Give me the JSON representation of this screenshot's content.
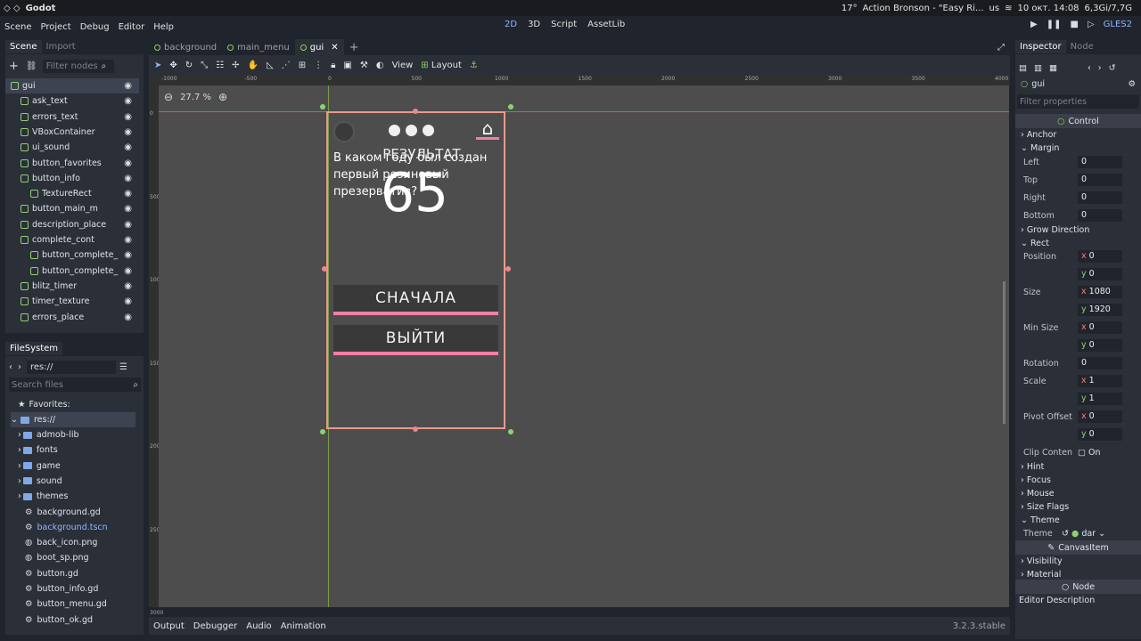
{
  "sysbar": {
    "app": "Godot",
    "temp": "17°",
    "media": "Action Bronson - \"Easy Ri...",
    "lang": "us",
    "datetime": "10 окт. 14:08",
    "mem": "6,3Gi/7,7G"
  },
  "menubar": {
    "items": [
      "Scene",
      "Project",
      "Debug",
      "Editor",
      "Help"
    ],
    "workspaces": [
      "2D",
      "3D",
      "Script",
      "AssetLib"
    ],
    "renderer": "GLES2"
  },
  "scene_panel": {
    "tabs": [
      "Scene",
      "Import"
    ],
    "filter_placeholder": "Filter nodes",
    "nodes": [
      "gui",
      "ask_text",
      "errors_text",
      "VBoxContainer",
      "ui_sound",
      "button_favorites",
      "button_info",
      "TextureRect",
      "button_main_m",
      "description_place",
      "complete_cont",
      "button_complete_",
      "button_complete_",
      "blitz_timer",
      "timer_texture",
      "errors_place"
    ]
  },
  "filesystem": {
    "title": "FileSystem",
    "path": "res://",
    "search_placeholder": "Search files",
    "favorites": "Favorites:",
    "root": "res://",
    "items": [
      "admob-lib",
      "fonts",
      "game",
      "sound",
      "themes",
      "background.gd",
      "background.tscn",
      "back_icon.png",
      "boot_sp.png",
      "button.gd",
      "button_info.gd",
      "button_menu.gd",
      "button_ok.gd"
    ]
  },
  "editor": {
    "tabs": [
      "background",
      "main_menu",
      "gui"
    ],
    "zoom": "27.7 %",
    "view": "View",
    "layout": "Layout",
    "ruler_h": [
      "-1000",
      "-500",
      "0",
      "500",
      "1000",
      "1500",
      "2000",
      "2500",
      "3000",
      "3500",
      "4000"
    ],
    "ruler_v": [
      "0",
      "500",
      "1000",
      "1500",
      "2000",
      "2500",
      "3000"
    ]
  },
  "game": {
    "question": "В каком году был создан первый резиновый презерватив?",
    "result_label": "РЕЗУЛЬТАТ",
    "score": "65",
    "btn_restart": "СНАЧАЛА",
    "btn_exit": "ВЫЙТИ",
    "home_icon": "home-icon"
  },
  "bottom": {
    "tabs": [
      "Output",
      "Debugger",
      "Audio",
      "Animation"
    ],
    "version": "3.2.3.stable"
  },
  "inspector": {
    "tabs": [
      "Inspector",
      "Node"
    ],
    "node": "gui",
    "filter_placeholder": "Filter properties",
    "control": "Control",
    "anchor": "Anchor",
    "margin": "Margin",
    "margins": [
      {
        "k": "Left",
        "v": "0"
      },
      {
        "k": "Top",
        "v": "0"
      },
      {
        "k": "Right",
        "v": "0"
      },
      {
        "k": "Bottom",
        "v": "0"
      }
    ],
    "grow": "Grow Direction",
    "rect": "Rect",
    "position": "Position",
    "pos_x": "0",
    "pos_y": "0",
    "size": "Size",
    "size_x": "1080",
    "size_y": "1920",
    "min_size": "Min Size",
    "min_x": "0",
    "min_y": "0",
    "rotation": "Rotation",
    "rotation_v": "0",
    "scale": "Scale",
    "scale_x": "1",
    "scale_y": "1",
    "pivot": "Pivot Offset",
    "pivot_x": "0",
    "pivot_y": "0",
    "clip": "Clip Conten",
    "clip_v": "On",
    "hint": "Hint",
    "focus": "Focus",
    "mouse": "Mouse",
    "size_flags": "Size Flags",
    "theme_sect": "Theme",
    "theme": "Theme",
    "theme_v": "dar",
    "canvas_item": "CanvasItem",
    "visibility": "Visibility",
    "material": "Material",
    "node_sect": "Node",
    "editor_desc": "Editor Description"
  }
}
